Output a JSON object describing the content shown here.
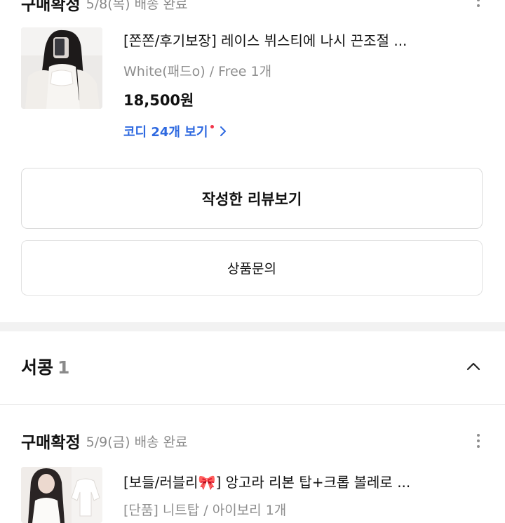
{
  "order1": {
    "status": "구매확정",
    "status_detail": "5/8(목) 배송 완료",
    "more_icon": "more-vertical-icon",
    "product": {
      "title": "[쫀쫀/후기보장] 레이스 뷔스티에 나시 끈조절 ...",
      "option": "White(패드o) / Free 1개",
      "price": "18,500원"
    },
    "codi_link": "코디 24개 보기",
    "review_button": "작성한 리뷰보기",
    "inquiry_button": "상품문의"
  },
  "seller": {
    "name": "서콩",
    "count": "1"
  },
  "order2": {
    "status": "구매확정",
    "status_detail": "5/9(금) 배송 완료",
    "product": {
      "title": "[보들/러블리🎀] 앙고라 리본 탑+크롭 볼레로 ...",
      "option": "[단품] 니트탑 / 아이보리 1개"
    }
  },
  "colors": {
    "link_blue": "#2e69e0",
    "badge_red": "#f2364a",
    "muted_text": "#8e8e8e",
    "border": "#dcdcdc"
  }
}
